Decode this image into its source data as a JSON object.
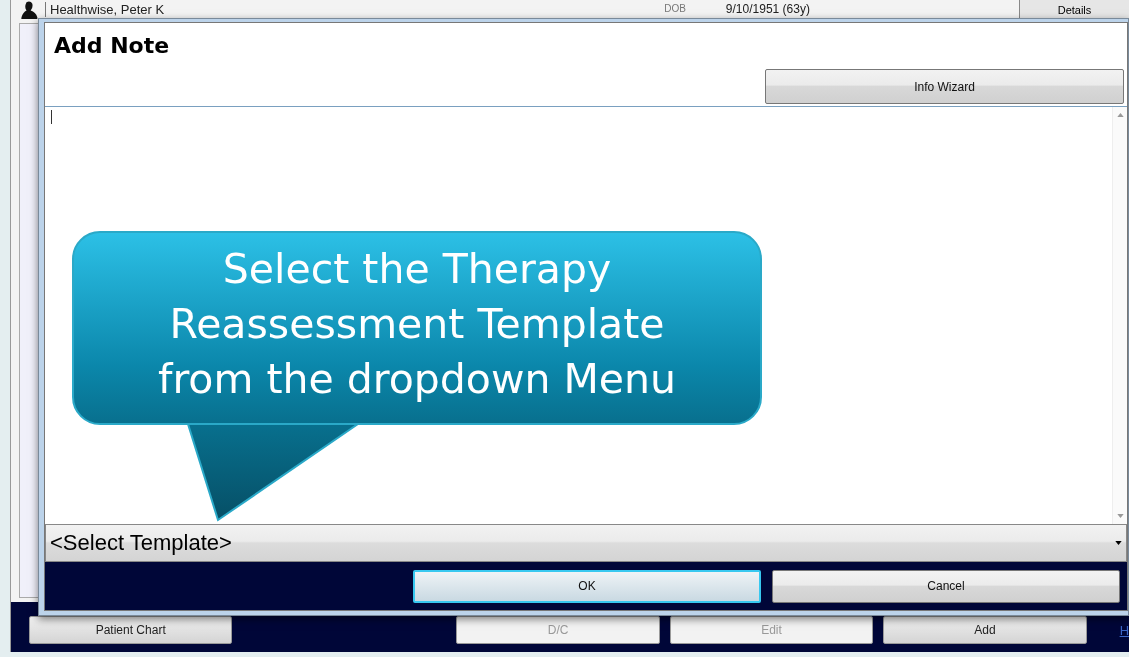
{
  "background_window": {
    "patient_name": "Healthwise, Peter K",
    "dob_label": "DOB",
    "dob": "9/10/1951 (63y)",
    "details_button": "Details",
    "buttons": [
      {
        "label": "Patient Chart",
        "disabled": false
      },
      {
        "label": "D/C",
        "disabled": true
      },
      {
        "label": "Edit",
        "disabled": true
      },
      {
        "label": "Add",
        "disabled": false
      }
    ],
    "link": "H"
  },
  "dialog": {
    "title": "Add Note",
    "info_button": "Info Wizard",
    "template_select": {
      "value": "<Select Template>"
    },
    "buttons": [
      {
        "label": "OK",
        "selected": true
      },
      {
        "label": "Cancel",
        "selected": false
      }
    ]
  },
  "callout": {
    "text": "Select the Therapy Reassessment Template from the dropdown Menu"
  }
}
